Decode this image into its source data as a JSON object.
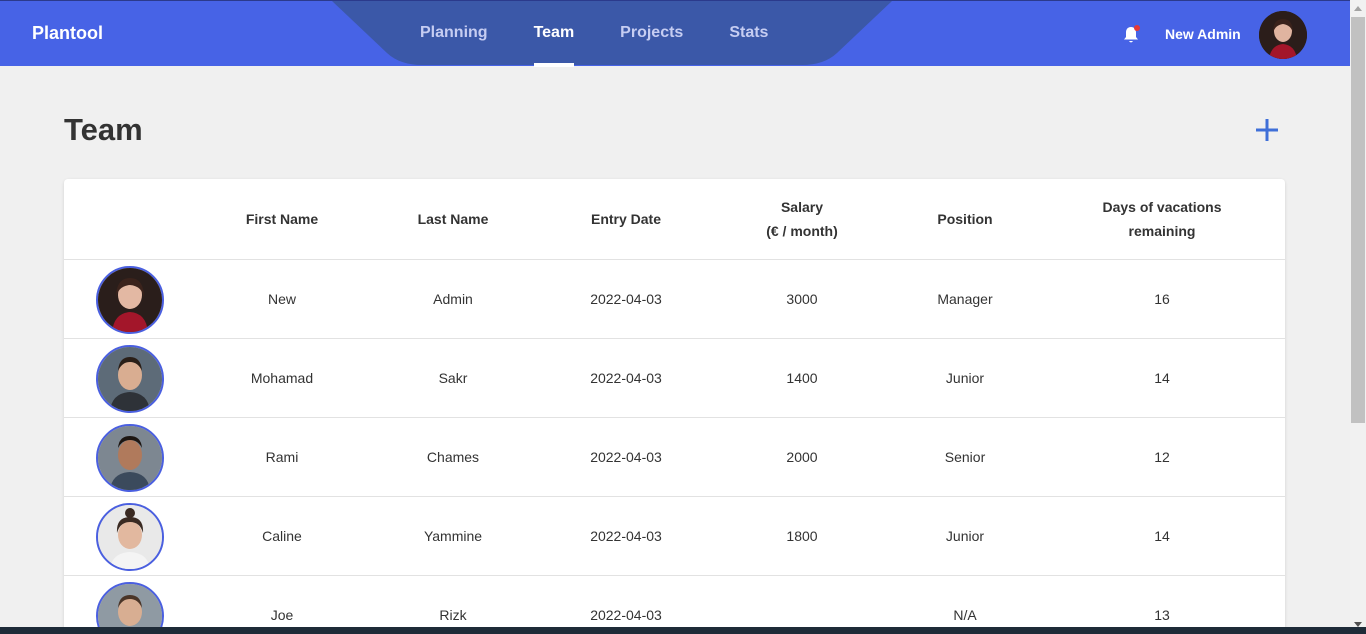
{
  "header": {
    "brand": "Plantool",
    "nav": [
      {
        "label": "Planning",
        "active": false
      },
      {
        "label": "Team",
        "active": true
      },
      {
        "label": "Projects",
        "active": false
      },
      {
        "label": "Stats",
        "active": false
      }
    ],
    "user_name": "New Admin",
    "notification_dot": true
  },
  "page": {
    "title": "Team"
  },
  "table": {
    "headers": {
      "first_name": "First Name",
      "last_name": "Last Name",
      "entry_date": "Entry Date",
      "salary_line1": "Salary",
      "salary_line2": "(€ / month)",
      "position": "Position",
      "days_line1": "Days of vacations",
      "days_line2": "remaining"
    },
    "rows": [
      {
        "first_name": "New",
        "last_name": "Admin",
        "entry_date": "2022-04-03",
        "salary": "3000",
        "position": "Manager",
        "days": "16"
      },
      {
        "first_name": "Mohamad",
        "last_name": "Sakr",
        "entry_date": "2022-04-03",
        "salary": "1400",
        "position": "Junior",
        "days": "14"
      },
      {
        "first_name": "Rami",
        "last_name": "Chames",
        "entry_date": "2022-04-03",
        "salary": "2000",
        "position": "Senior",
        "days": "12"
      },
      {
        "first_name": "Caline",
        "last_name": "Yammine",
        "entry_date": "2022-04-03",
        "salary": "1800",
        "position": "Junior",
        "days": "14"
      },
      {
        "first_name": "Joe",
        "last_name": "Rizk",
        "entry_date": "2022-04-03",
        "salary": "",
        "position": "N/A",
        "days": "13"
      }
    ]
  },
  "colors": {
    "accent": "#4763e6",
    "add_button": "#3f6fd8",
    "avatar_border": "#4a5fe0"
  }
}
